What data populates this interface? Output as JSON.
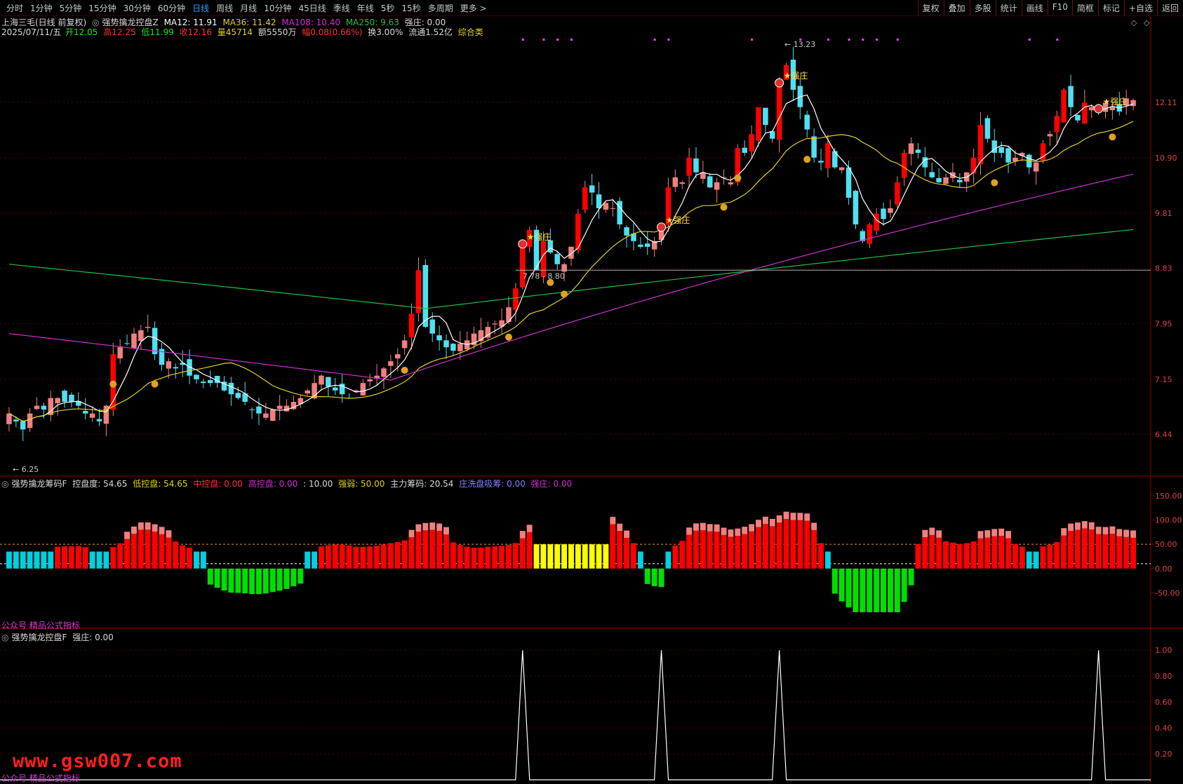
{
  "toolbar": {
    "tabs": [
      "分时",
      "1分钟",
      "5分钟",
      "15分钟",
      "30分钟",
      "60分钟",
      "日线",
      "周线",
      "月线",
      "10分钟",
      "45日线",
      "季线",
      "年线",
      "5秒",
      "15秒",
      "多周期",
      "更多 >"
    ],
    "active_tab": "日线",
    "buttons": [
      "复权",
      "叠加",
      "多股",
      "统计",
      "画线",
      "F10",
      "简框",
      "标记",
      "+自选",
      "返回"
    ]
  },
  "header": {
    "title": "上海三毛(日线 前复权)",
    "indicator": "强势擒龙控盘Z",
    "ma12": "MA12: 11.91",
    "ma36": "MA36: 11.42",
    "ma108": "MA108: 10.40",
    "ma250": "MA250: 9.63",
    "qiangzhuang": "强庄: 0.00",
    "date": "2025/07/11/五",
    "open": "开12.05",
    "high": "高12.25",
    "low": "低11.99",
    "close": "收12.16",
    "volume": "量45714",
    "amount": "额5550万",
    "change": "幅0.08(0.66%)",
    "turnover": "换3.00%",
    "float": "流通1.52亿",
    "sector": "综合类"
  },
  "price_axis": [
    "12.11",
    "10.90",
    "9.81",
    "8.83",
    "7.95",
    "7.15",
    "6.44"
  ],
  "annotations": {
    "high": "13.23",
    "low": "6.25",
    "line": "7.78 - 8.80",
    "qz": "强庄"
  },
  "panel2": {
    "name": "强势擒龙筹码F",
    "kongpan": "控盘度: 54.65",
    "low": "低控盘: 54.65",
    "mid": "中控盘: 0.00",
    "high": "高控盘: 0.00",
    "extra": ": 10.00",
    "qiangruo": "强弱: 50.00",
    "zhuli": "主力筹码: 20.54",
    "xipan": "庄洗盘吸筹: 0.00",
    "qz": "强庄: 0.00",
    "axis": [
      "150.00",
      "100.00",
      "50.00",
      "0.00",
      "-50.00"
    ],
    "footer": "公众号 精品公式指标"
  },
  "panel3": {
    "name": "强势擒龙控盘F",
    "qz": "强庄: 0.00",
    "axis": [
      "1.00",
      "0.80",
      "0.60",
      "0.40",
      "0.20"
    ],
    "footer": "公众号 精品公式指标"
  },
  "watermark": "www.gsw007.com",
  "colors": {
    "up": "#ff3030",
    "up_fill": "#f08080",
    "down": "#50e0f0",
    "ma12": "#ffffff",
    "ma36": "#e0d020",
    "ma108": "#d030d0",
    "ma250": "#20c040",
    "red": "#ff0000",
    "green": "#00e000",
    "cyan": "#00d0e0",
    "yellow": "#ffff00"
  },
  "chart_data": {
    "type": "candlestick",
    "close": [
      6.7,
      6.6,
      6.5,
      6.7,
      6.8,
      6.75,
      6.9,
      6.9,
      6.85,
      6.85,
      6.8,
      6.7,
      6.7,
      6.6,
      6.8,
      7.5,
      7.6,
      7.65,
      7.8,
      7.85,
      7.9,
      7.5,
      7.35,
      7.4,
      7.3,
      7.35,
      7.2,
      7.15,
      7.1,
      7.1,
      7.1,
      7.0,
      6.95,
      6.9,
      6.85,
      6.75,
      6.7,
      6.7,
      6.75,
      6.8,
      6.8,
      6.85,
      6.9,
      7.0,
      7.1,
      7.2,
      7.05,
      7.0,
      6.95,
      6.9,
      7.0,
      7.1,
      7.15,
      7.2,
      7.3,
      7.4,
      7.5,
      7.7,
      8.1,
      8.8,
      7.9,
      7.8,
      7.7,
      7.6,
      7.55,
      7.65,
      7.7,
      7.8,
      7.85,
      7.9,
      7.95,
      8.0,
      8.2,
      8.5,
      9.2,
      9.5,
      8.8,
      9.3,
      9.1,
      8.9,
      8.9,
      9.2,
      9.8,
      10.3,
      10.2,
      9.9,
      10.0,
      9.9,
      9.6,
      9.4,
      9.3,
      9.2,
      9.2,
      9.3,
      9.5,
      10.3,
      10.5,
      10.4,
      10.9,
      10.6,
      10.6,
      10.3,
      10.4,
      10.5,
      10.4,
      11.1,
      11.0,
      11.4,
      12.0,
      11.6,
      11.3,
      12.5,
      13.0,
      12.4,
      12.0,
      11.5,
      10.9,
      10.8,
      11.2,
      10.7,
      10.7,
      10.1,
      9.6,
      9.3,
      9.6,
      9.8,
      9.7,
      9.9,
      10.4,
      11.0,
      11.2,
      11.0,
      10.7,
      10.5,
      10.4,
      10.5,
      10.6,
      10.4,
      10.6,
      10.9,
      11.6,
      11.3,
      11.0,
      11.0,
      10.8,
      10.9,
      11.0,
      10.7,
      10.8,
      11.2,
      11.4,
      11.8,
      12.4,
      12.0,
      11.7,
      12.1,
      12.0,
      11.9,
      12.1,
      12.0,
      11.9,
      12.2,
      12.16
    ]
  }
}
